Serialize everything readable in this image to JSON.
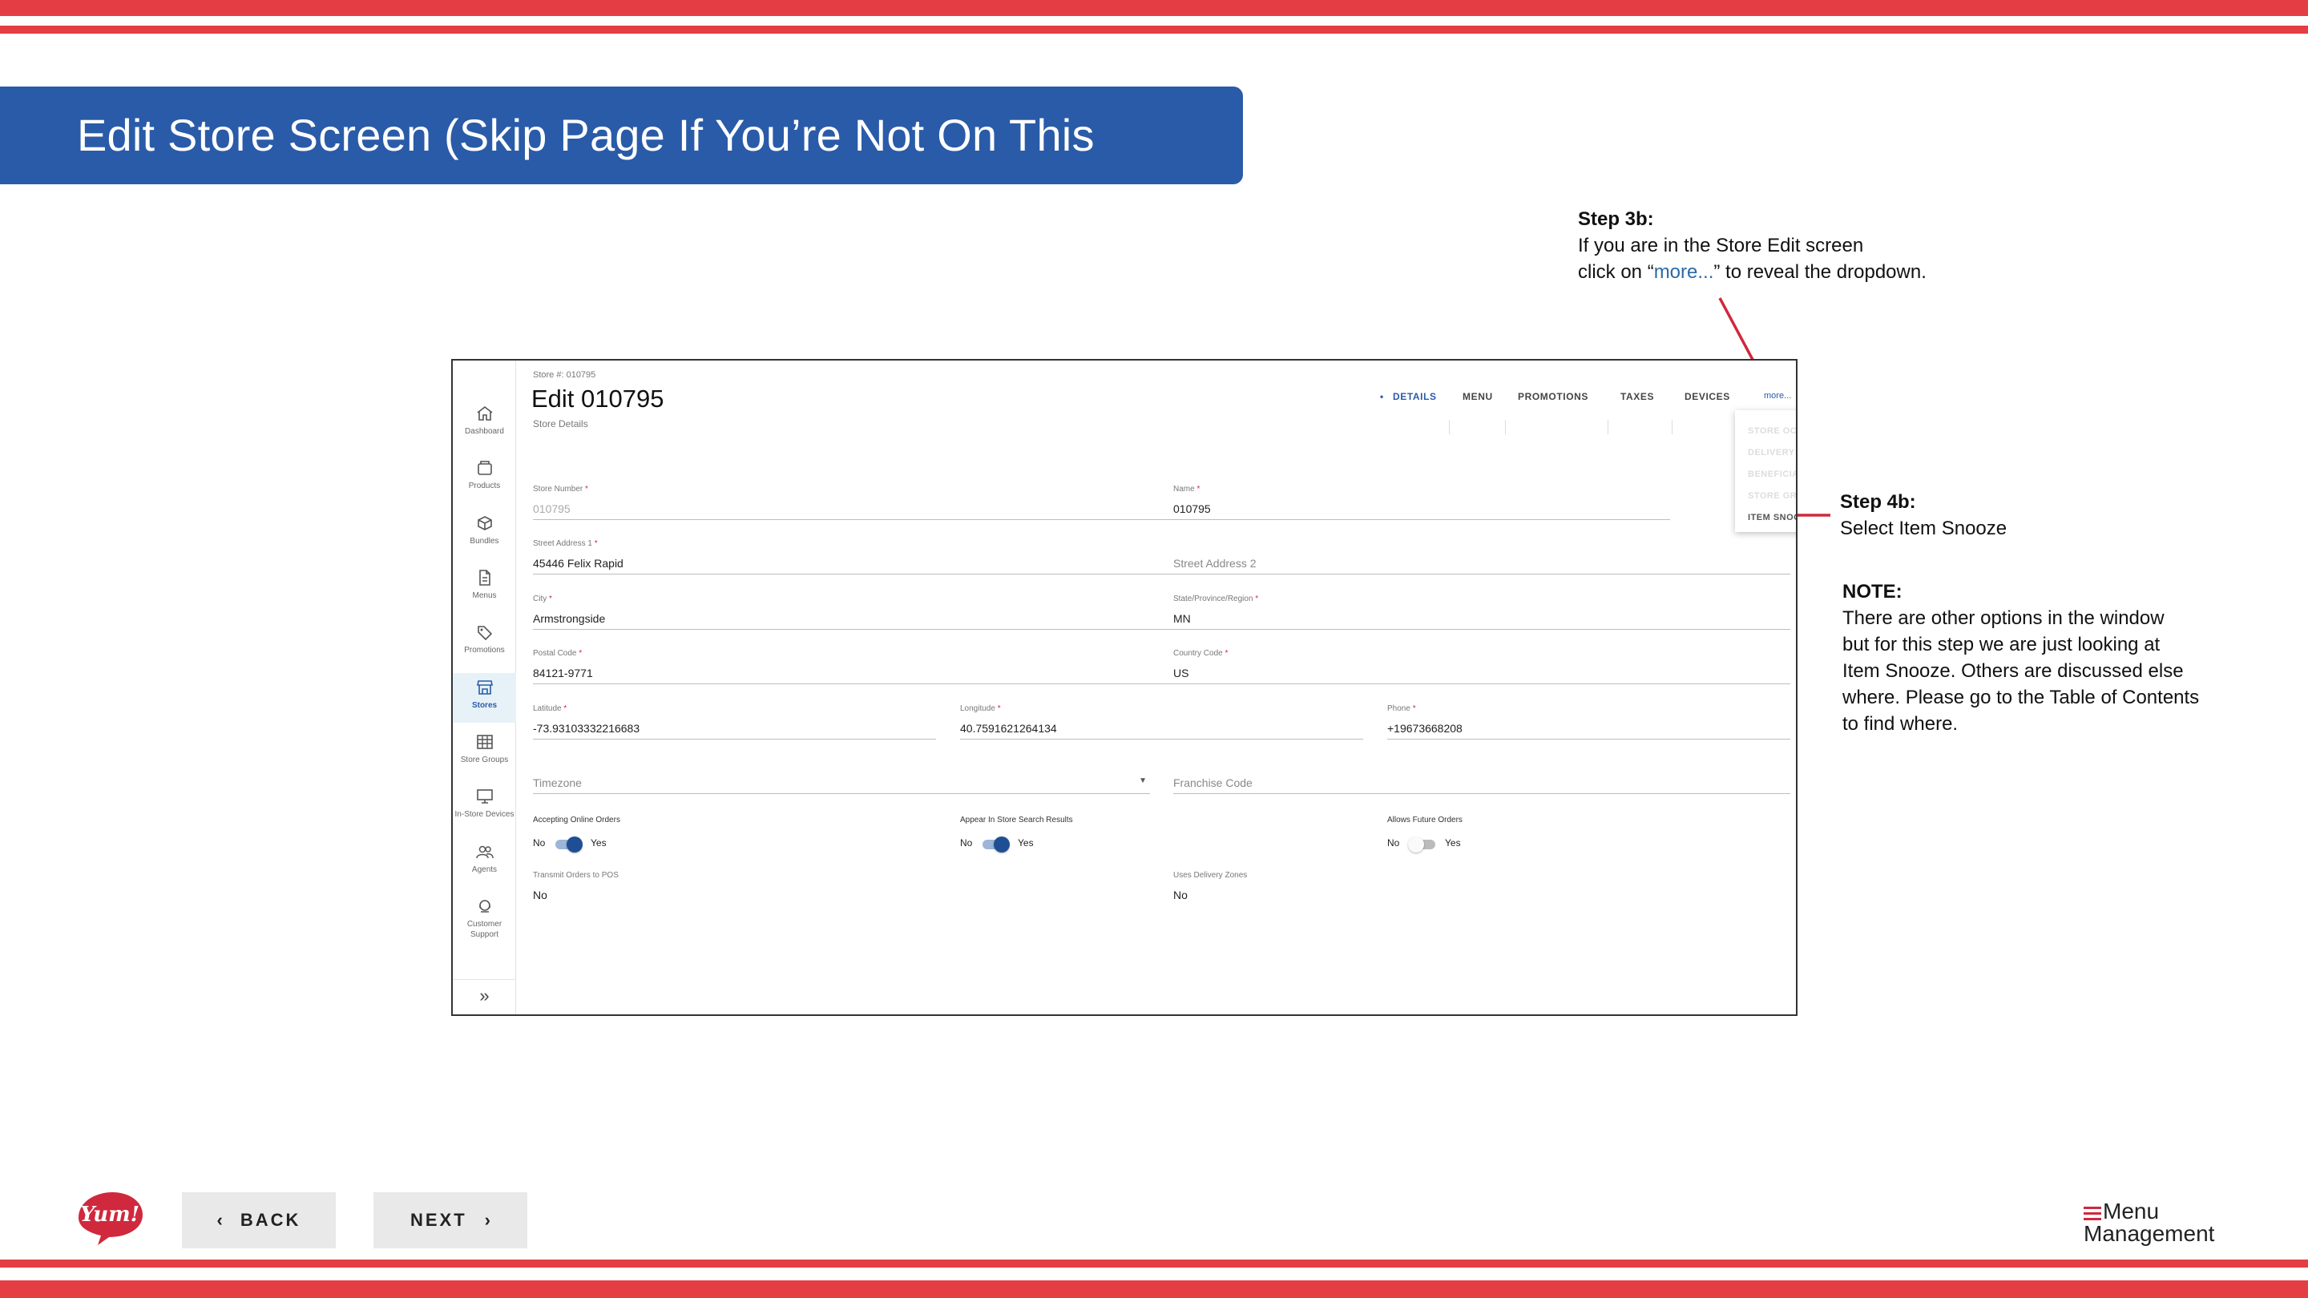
{
  "slide": {
    "title": "Edit Store Screen (Skip Page If You’re Not On This Screen)",
    "colors": {
      "stripe": "#e43d44",
      "banner": "#2a5ba8",
      "accent": "#d0283d",
      "link": "#2a6aa8"
    }
  },
  "annotations": {
    "step3b": {
      "heading": "Step 3b:",
      "line1": "If you are in the Store Edit screen",
      "line2_pre": "click on “",
      "line2_link": "more...",
      "line2_post": "” to reveal the dropdown."
    },
    "step4b": {
      "heading": "Step 4b:",
      "body": "Select Item Snooze"
    },
    "note": {
      "heading": "NOTE:",
      "lines": [
        "There are other options in the window",
        "but for this step we are just looking at",
        "Item Snooze. Others are discussed else",
        "where. Please go to the Table of Contents",
        "to find where."
      ]
    }
  },
  "app": {
    "sidebar": [
      {
        "label": "Dashboard",
        "icon": "home-icon"
      },
      {
        "label": "Products",
        "icon": "box-icon"
      },
      {
        "label": "Bundles",
        "icon": "cube-icon"
      },
      {
        "label": "Menus",
        "icon": "document-icon"
      },
      {
        "label": "Promotions",
        "icon": "tag-icon"
      },
      {
        "label": "Stores",
        "icon": "store-icon",
        "active": true
      },
      {
        "label": "Store Groups",
        "icon": "grid-icon"
      },
      {
        "label": "In-Store Devices",
        "icon": "monitor-icon"
      },
      {
        "label": "Agents",
        "icon": "people-icon"
      },
      {
        "label": "Customer Support",
        "icon": "support-icon"
      }
    ],
    "header": {
      "store_number_caption": "Store #: 010795",
      "title": "Edit 010795",
      "subtitle": "Store Details"
    },
    "tabs": [
      "DETAILS",
      "MENU",
      "PROMOTIONS",
      "TAXES",
      "DEVICES",
      "more..."
    ],
    "more_dropdown": [
      "STORE OCCASIONS",
      "DELIVERY",
      "BENEFICIARIES",
      "STORE GROUPS",
      "ITEM SNOOZE"
    ],
    "form": {
      "store_number": {
        "label": "Store Number",
        "value": "010795"
      },
      "name": {
        "label": "Name",
        "value": "010795"
      },
      "street1": {
        "label": "Street Address 1",
        "value": "45446 Felix Rapid"
      },
      "street2": {
        "placeholder": "Street Address 2"
      },
      "city": {
        "label": "City",
        "value": "Armstrongside"
      },
      "state": {
        "label": "State/Province/Region",
        "value": "MN"
      },
      "postal": {
        "label": "Postal Code",
        "value": "84121-9771"
      },
      "country": {
        "label": "Country Code",
        "value": "US"
      },
      "latitude": {
        "label": "Latitude",
        "value": "-73.93103332216683"
      },
      "longitude": {
        "label": "Longitude",
        "value": "40.7591621264134"
      },
      "phone": {
        "label": "Phone",
        "value": "+19673668208"
      },
      "timezone": {
        "placeholder": "Timezone"
      },
      "franchise": {
        "placeholder": "Franchise Code"
      },
      "accepting_online": {
        "label": "Accepting Online Orders",
        "no": "No",
        "yes": "Yes",
        "on": true
      },
      "appear_search": {
        "label": "Appear In Store Search Results",
        "no": "No",
        "yes": "Yes",
        "on": true
      },
      "future_orders": {
        "label": "Allows Future Orders",
        "no": "No",
        "yes": "Yes",
        "on": false
      },
      "transmit_pos": {
        "label": "Transmit Orders to POS",
        "value": "No"
      },
      "delivery_zones": {
        "label": "Uses Delivery Zones",
        "value": "No"
      },
      "required_mark": "*"
    }
  },
  "footer": {
    "back_label": "BACK",
    "next_label": "NEXT",
    "brand_logo_text": "Yum!",
    "product_logo": {
      "line1": "Menu",
      "line2": "Management"
    }
  }
}
